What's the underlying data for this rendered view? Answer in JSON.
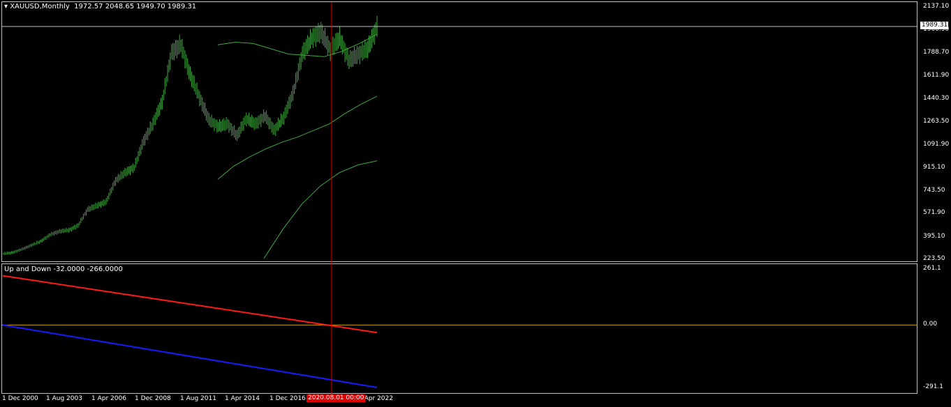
{
  "header": {
    "symbol": "XAUUSD,Monthly",
    "ohlc": "1972.57 2048.65 1949.70 1989.31"
  },
  "indicator": {
    "title": "Up and Down -32.0000 -266.0000"
  },
  "crosshair": {
    "date_label": "2020.08.01 00:00"
  },
  "colors": {
    "background": "#000000",
    "candles": "#3fa83f",
    "ma": "#3fa83f",
    "crosshair": "#e00000",
    "up_line": "#ff1a1a",
    "down_line": "#1a1aff",
    "zero_line": "#c8a000",
    "price_line": "#c0c0c0"
  },
  "chart_data": [
    {
      "type": "line",
      "x": [
        "1 Dec 2000",
        "1 Aug 2003",
        "1 Apr 2006",
        "1 Dec 2008",
        "1 Aug 2011",
        "1 Apr 2014",
        "1 Dec 2016",
        "1 Apr 2022"
      ],
      "y_ticks": [
        "2137.10",
        "1960.50",
        "1788.70",
        "1611.90",
        "1440.30",
        "1263.50",
        "1091.90",
        "915.10",
        "743.50",
        "571.90",
        "395.10",
        "223.50"
      ],
      "current_price": "1989.31",
      "ylim": [
        223.5,
        2137.1
      ],
      "series": [
        {
          "values": [
            265,
            275,
            300,
            330,
            360,
            410,
            435,
            445,
            480,
            600,
            630,
            660,
            820,
            880,
            920,
            1120,
            1250,
            1420,
            1790,
            1850,
            1620,
            1450,
            1280,
            1230,
            1250,
            1160,
            1290,
            1250,
            1310,
            1200,
            1300,
            1480,
            1780,
            1900,
            1950,
            1810,
            1900,
            1730,
            1780,
            1820,
            1990
          ]
        },
        {
          "values": [
            1850,
            1870,
            1860,
            1820,
            1780,
            1770,
            1760,
            1800,
            1860,
            1930
          ]
        },
        {
          "values": [
            830,
            930,
            1000,
            1060,
            1110,
            1150,
            1200,
            1250,
            1330,
            1400,
            1460
          ]
        },
        {
          "values": [
            230,
            450,
            640,
            780,
            880,
            940,
            970
          ]
        }
      ]
    },
    {
      "type": "line",
      "y_ticks": [
        "261.1",
        "0.00",
        "-291.1"
      ],
      "ylim": [
        -291.1,
        261.1
      ],
      "series": [
        {
          "values": [
            230,
            -35
          ]
        },
        {
          "values": [
            0,
            -291.1
          ]
        }
      ]
    }
  ]
}
